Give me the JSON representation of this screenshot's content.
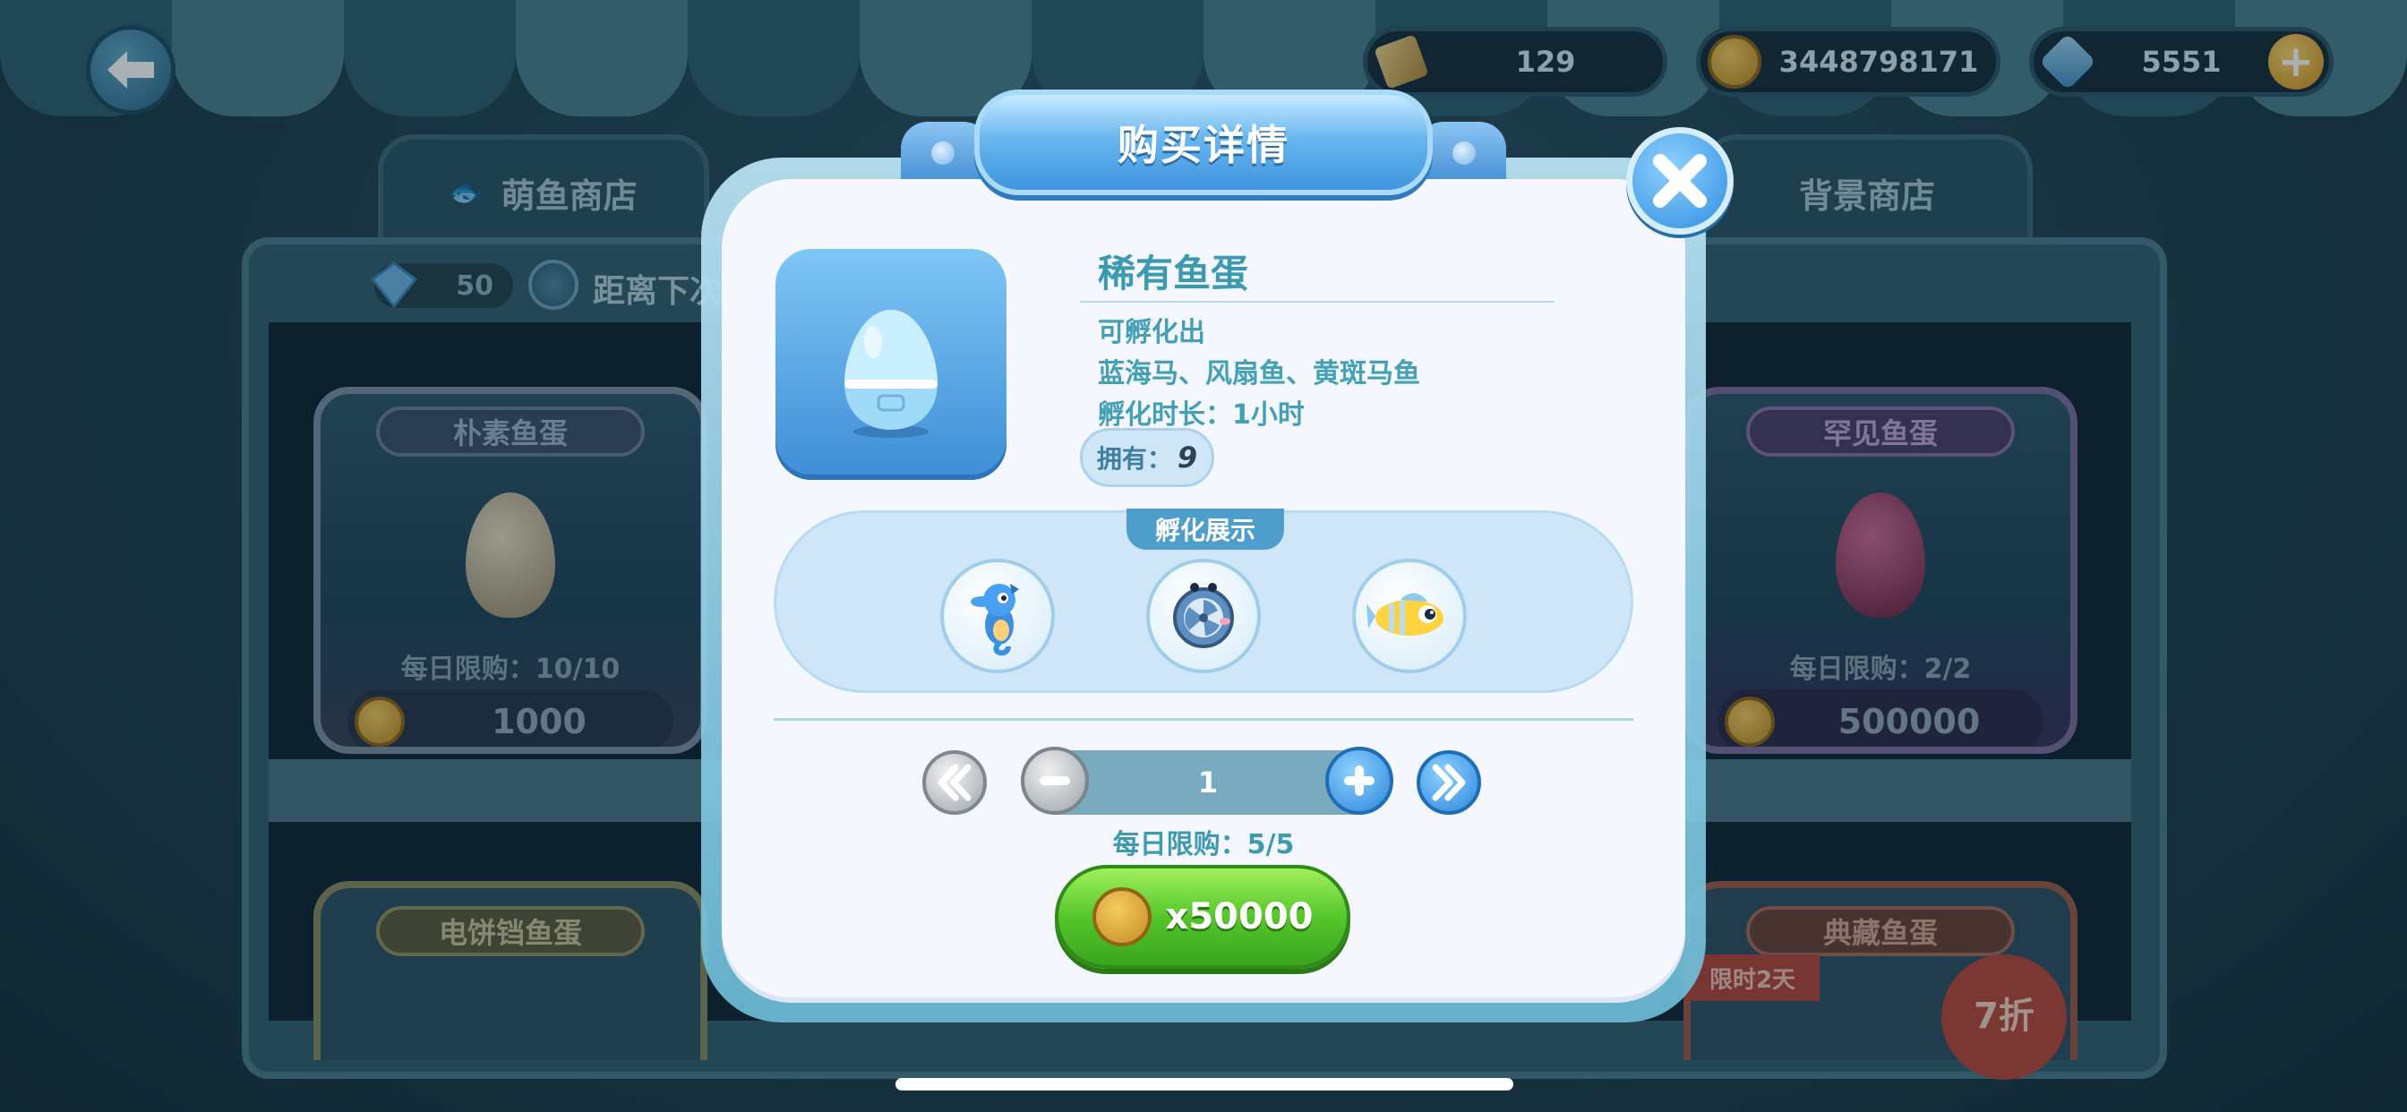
{
  "topbar": {
    "tickets": "129",
    "coins": "3448798171",
    "gems": "5551"
  },
  "tabs": {
    "cute_fish_shop": "萌鱼商店",
    "background_shop": "背景商店"
  },
  "shop_info": {
    "gem_count": "50",
    "timer_text": "距离下次"
  },
  "shelf_items": [
    {
      "title": "朴素鱼蛋",
      "daily_limit": "每日限购：10/10",
      "price": "1000"
    },
    {
      "title": "罕见鱼蛋",
      "daily_limit": "每日限购：2/2",
      "price": "500000"
    },
    {
      "title": "电饼铛鱼蛋"
    },
    {
      "title": "典藏鱼蛋",
      "limited_tag": "限时2天",
      "discount": "7折"
    }
  ],
  "modal": {
    "title": "购买详情",
    "item_name": "稀有鱼蛋",
    "hatch_label": "可孵化出",
    "hatch_fish": "蓝海马、风扇鱼、黄斑马鱼",
    "hatch_time": "孵化时长：1小时",
    "owned_label": "拥有：",
    "owned_count": "9",
    "showcase_label": "孵化展示",
    "showcase_fish": [
      "blue-seahorse-icon",
      "fan-fish-icon",
      "yellow-zebrafish-icon"
    ],
    "quantity": "1",
    "daily_limit": "每日限购：5/5",
    "price": "x50000"
  },
  "colors": {
    "accent_blue": "#3f95dc",
    "text_teal": "#3b9ab0",
    "buy_green": "#56c62b",
    "coin_gold": "#f5cc61"
  }
}
